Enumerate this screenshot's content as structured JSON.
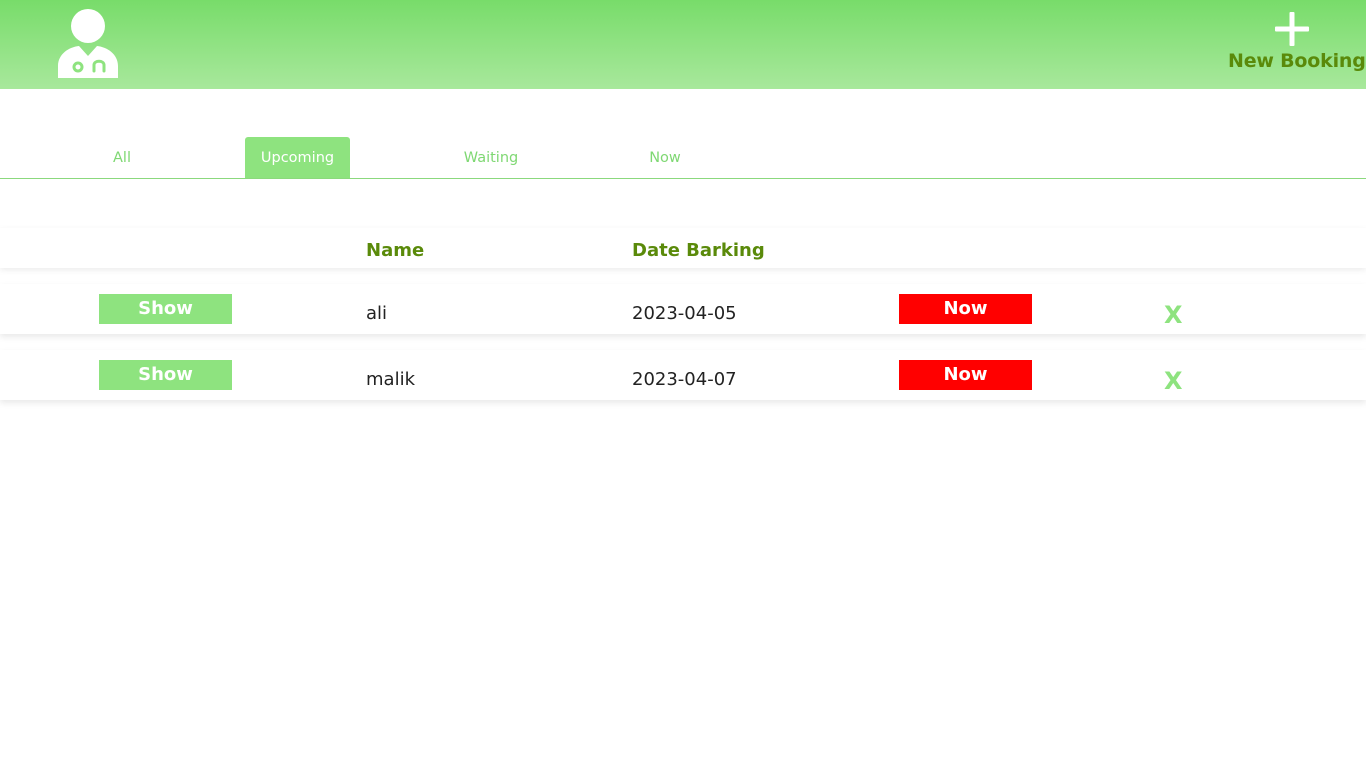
{
  "header": {
    "logo_icon": "doctor-icon",
    "new_booking": {
      "icon": "plus-icon",
      "label": "New Booking"
    }
  },
  "tabs": [
    {
      "label": "All",
      "active": false
    },
    {
      "label": "Upcoming",
      "active": true
    },
    {
      "label": "Waiting",
      "active": false
    },
    {
      "label": "Now",
      "active": false
    }
  ],
  "table": {
    "columns": [
      "",
      "Name",
      "Date Barking",
      "",
      ""
    ],
    "rows": [
      {
        "show_label": "Show",
        "name": "ali",
        "date": "2023-04-05",
        "status_label": "Now",
        "delete_label": "X"
      },
      {
        "show_label": "Show",
        "name": "malik",
        "date": "2023-04-07",
        "status_label": "Now",
        "delete_label": "X"
      }
    ]
  },
  "colors": {
    "header_gradient_top": "#78dc6a",
    "header_gradient_bottom": "#a8e89c",
    "accent_green": "#8ee37f",
    "heading_olive": "#5a8a0a",
    "now_red": "#ff0000"
  }
}
